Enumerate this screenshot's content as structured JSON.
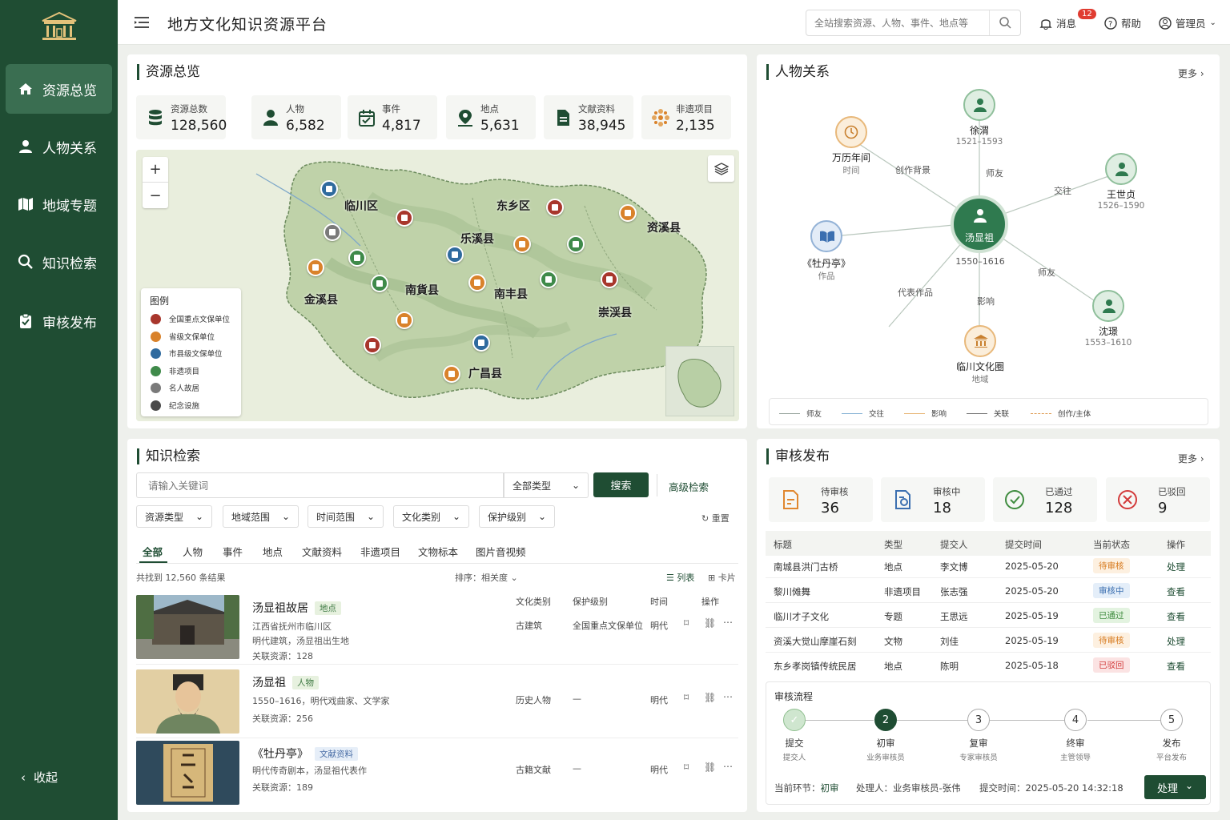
{
  "app": {
    "title": "地方文化知识资源平台"
  },
  "topbar": {
    "search_placeholder": "全站搜索资源、人物、事件、地点等",
    "messages": "消息",
    "messages_badge": "12",
    "help": "帮助",
    "user": "管理员"
  },
  "sidebar": {
    "items": [
      {
        "label": "资源总览"
      },
      {
        "label": "人物关系"
      },
      {
        "label": "地域专题"
      },
      {
        "label": "知识检索"
      },
      {
        "label": "审核发布"
      }
    ],
    "collapse": "收起"
  },
  "overview": {
    "title": "资源总览",
    "stats": [
      {
        "label": "资源总数",
        "value": "128,560"
      },
      {
        "label": "人物",
        "value": "6,582"
      },
      {
        "label": "事件",
        "value": "4,817"
      },
      {
        "label": "地点",
        "value": "5,631"
      },
      {
        "label": "文献资料",
        "value": "38,945"
      },
      {
        "label": "非遗项目",
        "value": "2,135"
      }
    ],
    "map_labels": [
      "临川区",
      "东乡区",
      "乐溪县",
      "资溪县",
      "金溪县",
      "南貨县",
      "南丰县",
      "崇渓县",
      "广昌县"
    ],
    "legend": {
      "title": "图例",
      "items": [
        "全国重点文保单位",
        "省级文保单位",
        "市县级文保单位",
        "非遗项目",
        "名人故居",
        "纪念设施"
      ],
      "colors": [
        "#a8362c",
        "#d9822b",
        "#2f6a9e",
        "#3f8a4a",
        "#7a7a7a",
        "#4a4a4a"
      ]
    }
  },
  "relations": {
    "title": "人物关系",
    "more": "更多",
    "center": {
      "name": "汤显祖",
      "years": "1550–1616"
    },
    "nodes": [
      {
        "name": "徐渭",
        "sub": "1521–1593"
      },
      {
        "name": "王世贞",
        "sub": "1526–1590"
      },
      {
        "name": "沈璟",
        "sub": "1553–1610"
      },
      {
        "name": "临川文化圈",
        "sub": "地域"
      },
      {
        "name": "《牡丹亭》",
        "sub": "作品"
      },
      {
        "name": "万历年间",
        "sub": "时间"
      }
    ],
    "edges": [
      "师友",
      "交往",
      "师友",
      "影响",
      "代表作品",
      "创作背景"
    ],
    "legend": [
      "师友",
      "交往",
      "影响",
      "关联",
      "创作/主体"
    ]
  },
  "search": {
    "title": "知识检索",
    "placeholder": "请输入关键词",
    "type_select": "全部类型",
    "search_btn": "搜索",
    "advanced": "高级检索",
    "filters": [
      "资源类型",
      "地域范围",
      "时间范围",
      "文化类别",
      "保护级别"
    ],
    "reset": "重置",
    "tabs": [
      "全部",
      "人物",
      "事件",
      "地点",
      "文献资料",
      "非遗项目",
      "文物标本",
      "图片音视频"
    ],
    "count": "共找到 12,560 条结果",
    "sort": "排序：相关度",
    "view_list": "列表",
    "view_card": "卡片",
    "columns": [
      "文化类别",
      "保护级别",
      "时间",
      "操作"
    ],
    "results": [
      {
        "title": "汤显祖故居",
        "tag": "地点",
        "line1": "江西省抚州市临川区",
        "line2": "明代建筑，汤显祖出生地",
        "related": "关联资源：128",
        "category": "古建筑",
        "level": "全国重点文保单位",
        "time": "明代"
      },
      {
        "title": "汤显祖",
        "tag": "人物",
        "line1": "1550–1616，明代戏曲家、文学家",
        "line2": "",
        "related": "关联资源：256",
        "category": "历史人物",
        "level": "—",
        "time": "明代"
      },
      {
        "title": "《牡丹亭》",
        "tag": "文献资料",
        "line1": "明代传奇剧本，汤显祖代表作",
        "line2": "",
        "related": "关联资源：189",
        "category": "古籍文献",
        "level": "—",
        "time": "明代"
      }
    ]
  },
  "review": {
    "title": "审核发布",
    "more": "更多",
    "cards": [
      {
        "label": "待审核",
        "value": "36"
      },
      {
        "label": "审核中",
        "value": "18"
      },
      {
        "label": "已通过",
        "value": "128"
      },
      {
        "label": "已驳回",
        "value": "9"
      }
    ],
    "headers": [
      "标题",
      "类型",
      "提交人",
      "提交时间",
      "当前状态",
      "操作"
    ],
    "rows": [
      {
        "title": "南城县洪门古桥",
        "type": "地点",
        "submitter": "李文博",
        "date": "2025-05-20",
        "status": "待审核",
        "op": "处理"
      },
      {
        "title": "黎川傩舞",
        "type": "非遗项目",
        "submitter": "张志强",
        "date": "2025-05-20",
        "status": "审核中",
        "op": "查看"
      },
      {
        "title": "临川才子文化",
        "type": "专题",
        "submitter": "王思远",
        "date": "2025-05-19",
        "status": "已通过",
        "op": "查看"
      },
      {
        "title": "资溪大觉山摩崖石刻",
        "type": "文物",
        "submitter": "刘佳",
        "date": "2025-05-19",
        "status": "待审核",
        "op": "处理"
      },
      {
        "title": "东乡孝岗镇传统民居",
        "type": "地点",
        "submitter": "陈明",
        "date": "2025-05-18",
        "status": "已驳回",
        "op": "查看"
      }
    ],
    "flow": {
      "title": "审核流程",
      "steps": [
        {
          "num": "",
          "label": "提交",
          "sub": "提交人"
        },
        {
          "num": "2",
          "label": "初审",
          "sub": "业务审核员"
        },
        {
          "num": "3",
          "label": "复审",
          "sub": "专家审核员"
        },
        {
          "num": "4",
          "label": "终审",
          "sub": "主管领导"
        },
        {
          "num": "5",
          "label": "发布",
          "sub": "平台发布"
        }
      ],
      "current_label": "当前环节：",
      "current": "初审",
      "handler": "处理人：业务审核员-张伟",
      "time": "提交时间：2025-05-20 14:32:18",
      "action": "处理"
    }
  }
}
